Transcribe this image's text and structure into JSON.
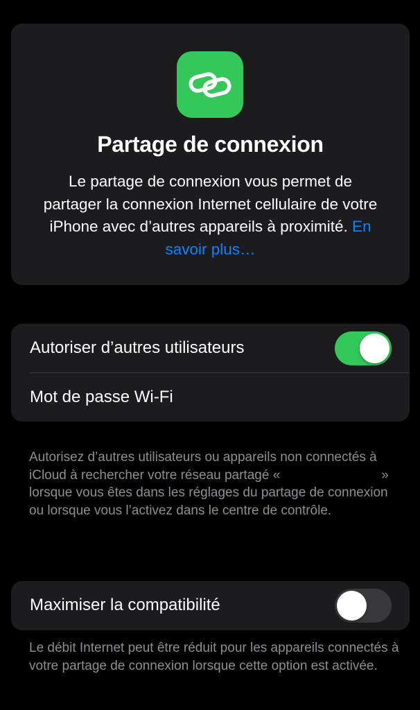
{
  "hero": {
    "icon": "link-icon",
    "icon_color": "#34c759",
    "title": "Partage de connexion",
    "description": "Le partage de connexion vous permet de partager la connexion Internet cellulaire de votre iPhone avec d’autres appareils à proximité.",
    "learn_more": "En savoir plus…",
    "link_color": "#0a84ff"
  },
  "settings": {
    "allow_others": {
      "label": "Autoriser d’autres utilisateurs",
      "enabled": true
    },
    "wifi_password": {
      "label": "Mot de passe Wi-Fi"
    },
    "allow_others_footnote": {
      "before": "Autorisez d’autres utilisateurs ou appareils non connectés à iCloud à rechercher votre réseau partagé «",
      "network_name": "",
      "after": "» lorsque vous êtes dans les réglages du partage de connexion ou lorsque vous l’activez dans le centre de contrôle."
    },
    "maximize_compat": {
      "label": "Maximiser la compatibilité",
      "enabled": false
    },
    "maximize_compat_footnote": "Le débit Internet peut être réduit pour les appareils connectés à votre partage de connexion lorsque cette option est activée."
  },
  "colors": {
    "background": "#000000",
    "card": "#1c1c1e",
    "toggle_on": "#34c759",
    "toggle_off": "#39393d",
    "footnote": "#8e8e93"
  }
}
